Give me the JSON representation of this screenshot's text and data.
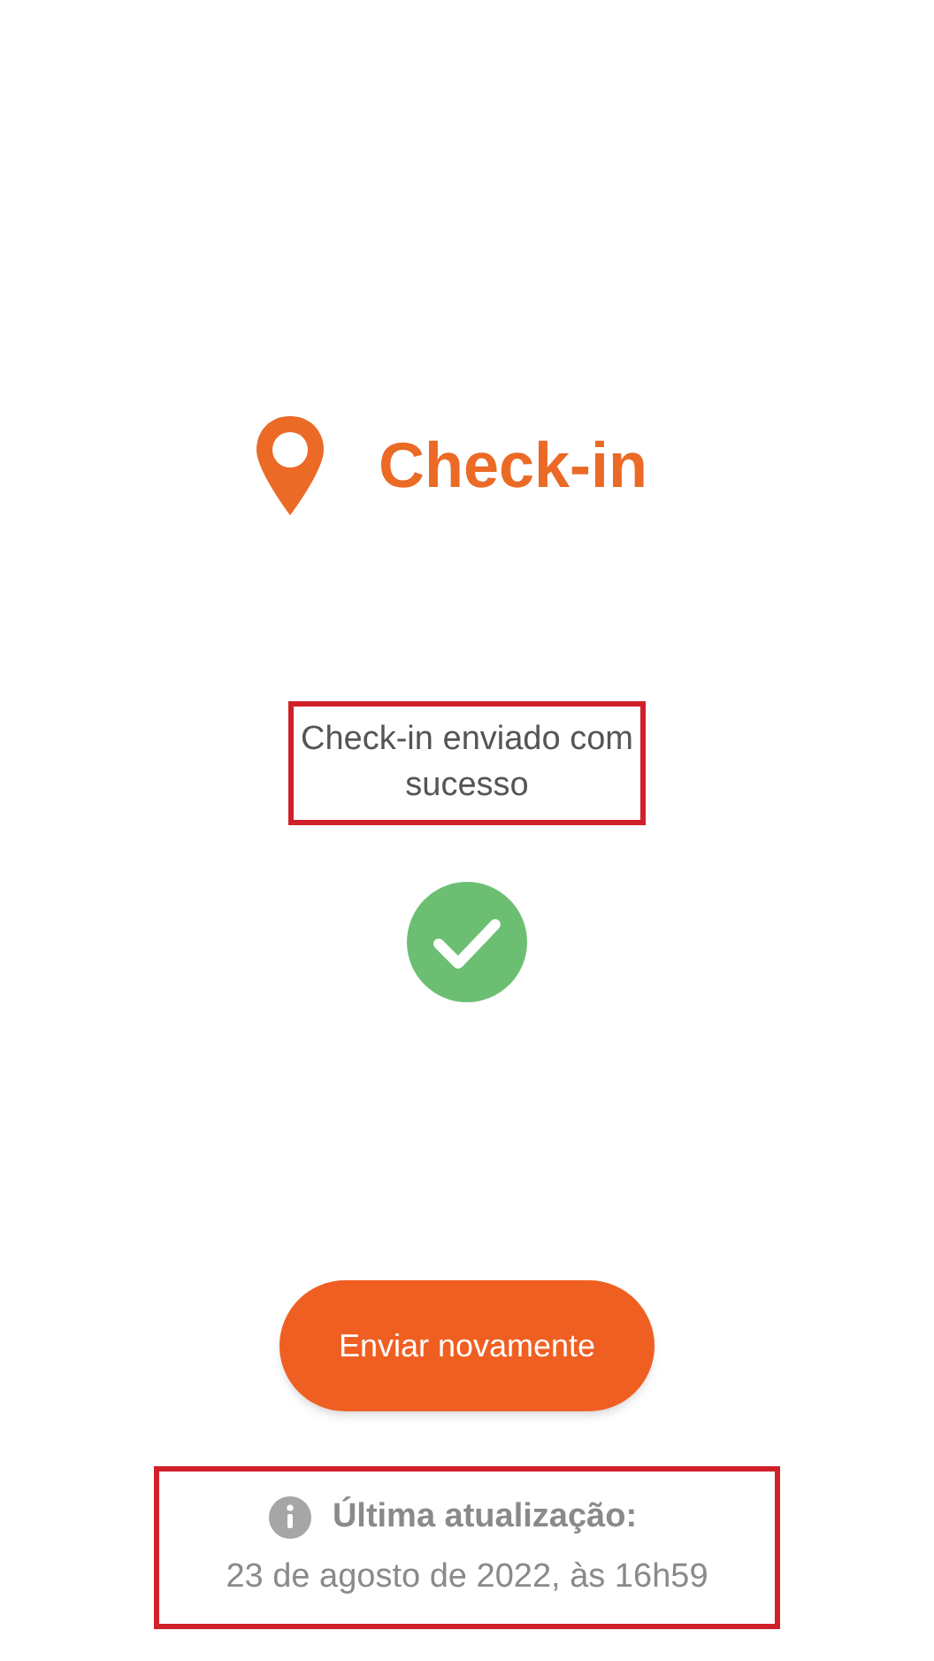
{
  "header": {
    "title": "Check-in"
  },
  "status": {
    "message": "Check-in enviado com sucesso",
    "highlighted": true,
    "success": true
  },
  "resend_button": {
    "label": "Enviar novamente"
  },
  "last_update": {
    "label": "Última atualização:",
    "value": "23 de agosto de 2022, às 16h59",
    "highlighted": true
  }
}
